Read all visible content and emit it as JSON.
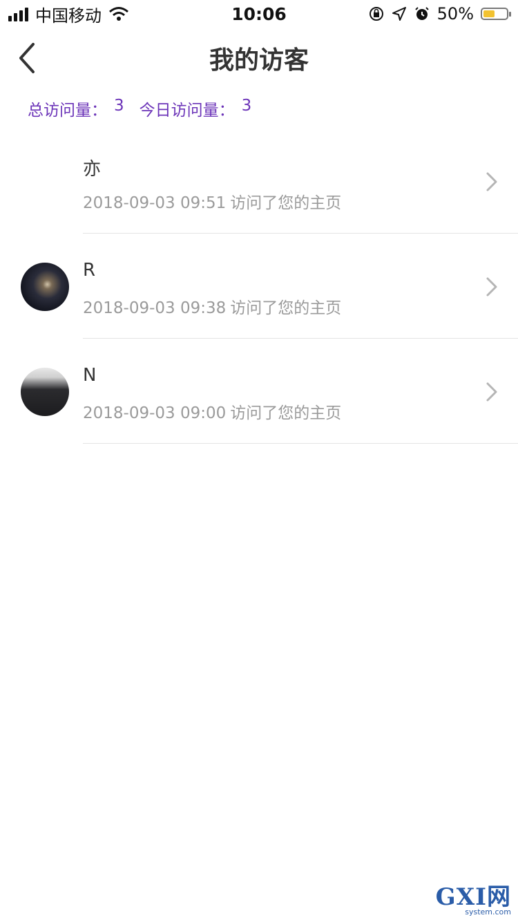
{
  "status_bar": {
    "carrier": "中国移动",
    "time": "10:06",
    "battery_percent_text": "50%",
    "battery_level": 0.5,
    "battery_color": "#f2c230",
    "icons": [
      "signal-icon",
      "wifi-icon",
      "rotation-lock-icon",
      "location-icon",
      "alarm-icon",
      "battery-icon"
    ]
  },
  "nav": {
    "title": "我的访客",
    "back_icon": "chevron-left-icon"
  },
  "stats": {
    "total_label": "总访问量：",
    "total_value": "3",
    "today_label": "今日访问量：",
    "today_value": "3",
    "color": "#6b33b8"
  },
  "visitors": [
    {
      "name": "亦",
      "time": "2018-09-03 09:51",
      "message": "访问了您的主页",
      "avatar": "blank"
    },
    {
      "name": "R",
      "time": "2018-09-03 09:38",
      "message": "访问了您的主页",
      "avatar": "galaxy"
    },
    {
      "name": "N",
      "time": "2018-09-03 09:00",
      "message": "访问了您的主页",
      "avatar": "person"
    }
  ],
  "watermark": {
    "big": "GXI网",
    "small": "system.com"
  }
}
